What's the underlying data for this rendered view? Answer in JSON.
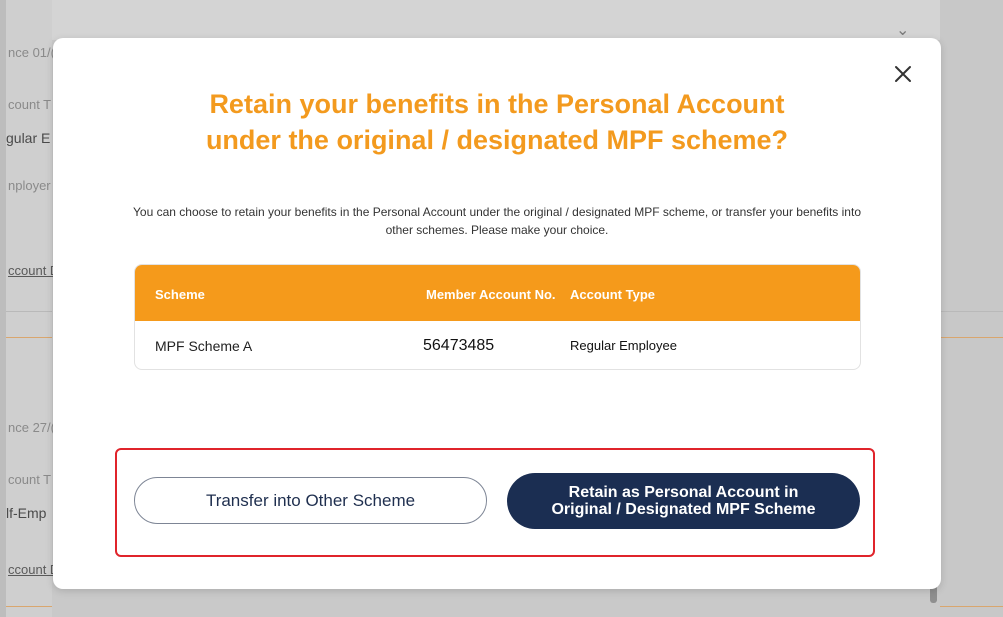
{
  "background": {
    "left_labels": [
      "nce 01/(",
      "count T",
      "gular E",
      "nployer",
      "ccount D",
      "nce 27/(",
      "count T",
      "lf-Emp",
      "ccount D"
    ]
  },
  "modal": {
    "title_line1": "Retain your benefits in the Personal Account",
    "title_line2": "under the original / designated MPF scheme?",
    "description": "You can choose to retain your benefits in the Personal Account under the original / designated MPF scheme, or transfer your benefits into other schemes. Please make your choice.",
    "table": {
      "headers": [
        "Scheme",
        "Member Account No.",
        "Account Type"
      ],
      "rows": [
        [
          "MPF Scheme A",
          "56473485",
          "Regular Employee"
        ]
      ]
    },
    "buttons": {
      "transfer": "Transfer into Other Scheme",
      "retain_line1": "Retain as Personal Account in",
      "retain_line2": "Original / Designated MPF Scheme"
    }
  },
  "colors": {
    "title": "#f39a1e",
    "table_header": "#f59a1b",
    "primary_button": "#1b2e52",
    "highlight_border": "#e0242b"
  }
}
